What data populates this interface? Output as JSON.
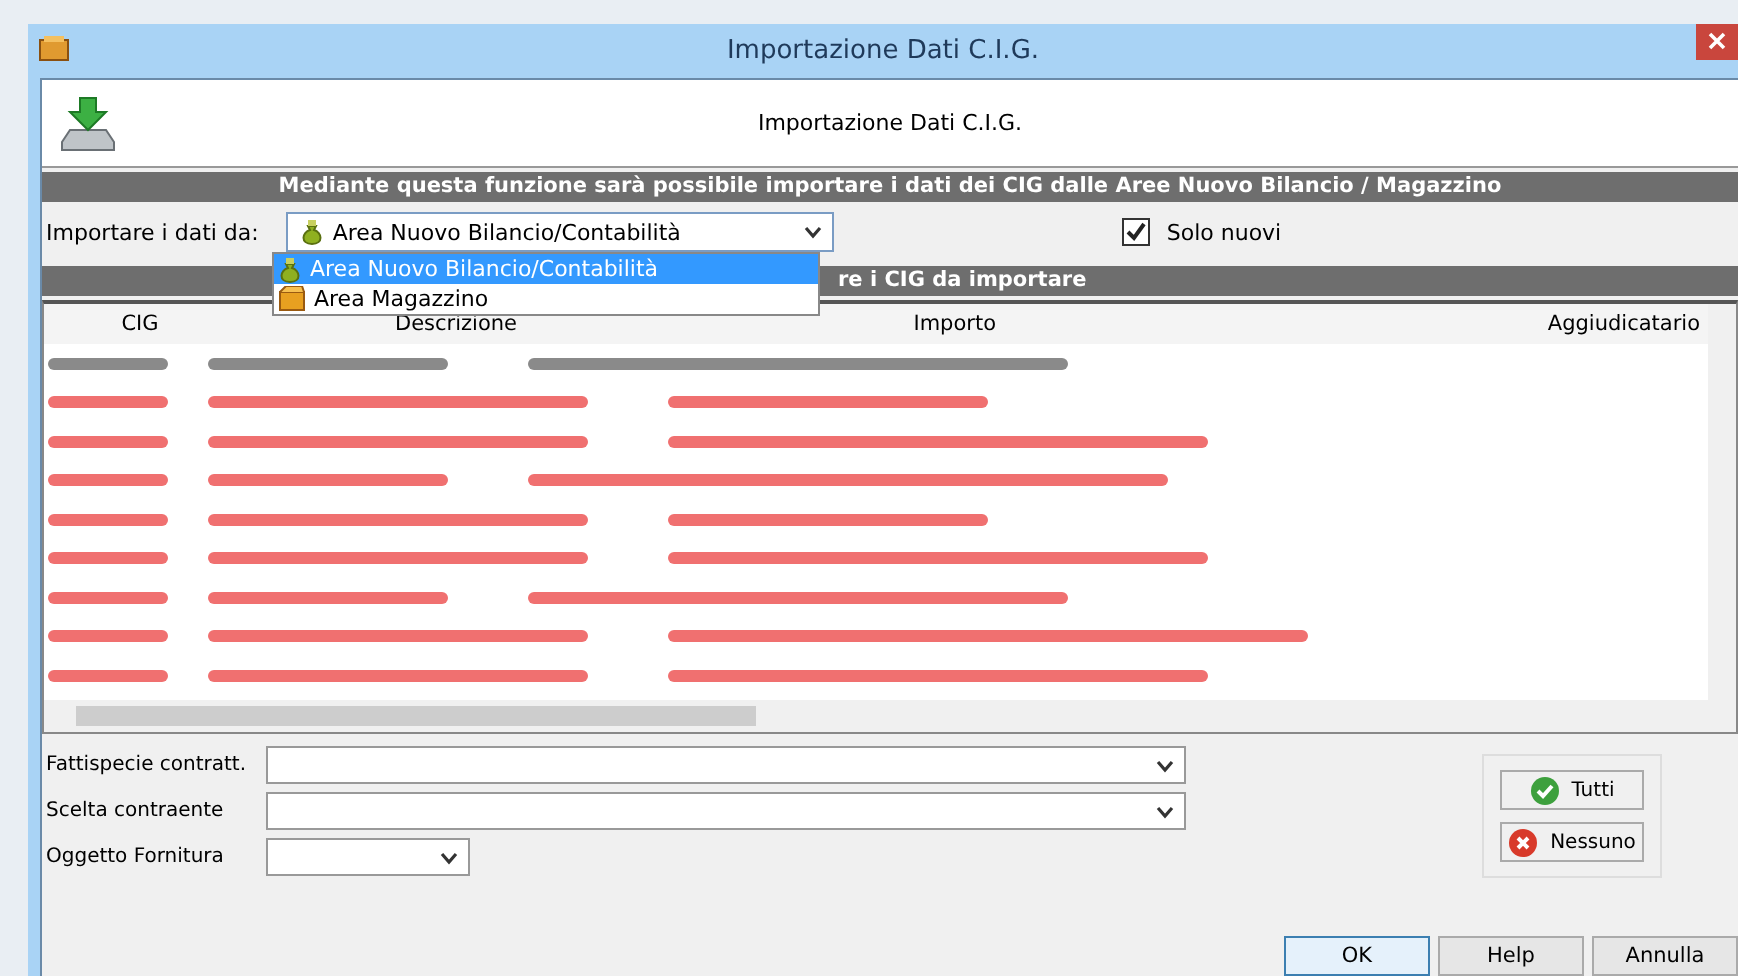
{
  "window": {
    "title": "Importazione Dati C.I.G."
  },
  "header": {
    "title": "Importazione Dati C.I.G."
  },
  "info_bar": "Mediante questa funzione sarà possibile importare i dati dei CIG dalle Aree Nuovo Bilancio / Magazzino",
  "source": {
    "label": "Importare i dati da:",
    "value": "Area Nuovo Bilancio/Contabilità",
    "options": [
      {
        "label": "Area Nuovo Bilancio/Contabilità",
        "kind": "bag",
        "selected": true
      },
      {
        "label": "Area Magazzino",
        "kind": "box",
        "selected": false
      }
    ]
  },
  "solo_nuovi": {
    "label": "Solo nuovi",
    "checked": true
  },
  "table": {
    "title": "re i CIG da importare",
    "columns": [
      "CIG",
      "Descrizione",
      "Importo",
      "Aggiudicatario"
    ],
    "rows": [
      {
        "color": "#8a8a8a"
      },
      {
        "color": "#f07070"
      },
      {
        "color": "#f07070"
      },
      {
        "color": "#f07070"
      },
      {
        "color": "#f07070"
      },
      {
        "color": "#f07070"
      },
      {
        "color": "#f07070"
      },
      {
        "color": "#f07070"
      },
      {
        "color": "#f07070"
      }
    ]
  },
  "filters": [
    {
      "label": "Fattispecie contratt.",
      "kind": "wide"
    },
    {
      "label": "Scelta contraente",
      "kind": "wide"
    },
    {
      "label": "Oggetto Fornitura",
      "kind": "narrow"
    }
  ],
  "selection_buttons": [
    {
      "label": "Tutti",
      "kind": "check"
    },
    {
      "label": "Nessuno",
      "kind": "cross"
    }
  ],
  "buttons": [
    "OK",
    "Help",
    "Annulla"
  ]
}
